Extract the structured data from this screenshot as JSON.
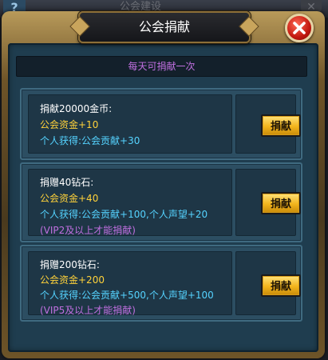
{
  "background": {
    "title": "公会建设",
    "help_icon": "?"
  },
  "dialog": {
    "title": "公会捐献",
    "notice": "每天可捐献一次"
  },
  "options": [
    {
      "title": "捐献20000金币:",
      "fund": "公会资金+10",
      "personal": "个人获得:公会贡献+30",
      "vip": "",
      "button": "捐献"
    },
    {
      "title": "捐赠40钻石:",
      "fund": "公会资金+40",
      "personal": "个人获得:公会贡献+100,个人声望+20",
      "vip": "(VIP2及以上才能捐献)",
      "button": "捐献"
    },
    {
      "title": "捐赠200钻石:",
      "fund": "公会资金+200",
      "personal": "个人获得:公会贡献+500,个人声望+100",
      "vip": "(VIP5及以上才能捐献)",
      "button": "捐献"
    }
  ],
  "colors": {
    "fund_text": "#ffd23a",
    "personal_text": "#55d3ff",
    "vip_text": "#c06fe0",
    "button_gold": "#f2b41c",
    "close_red": "#c2180f"
  },
  "icons": {
    "close": "close-icon",
    "help": "help-icon"
  }
}
